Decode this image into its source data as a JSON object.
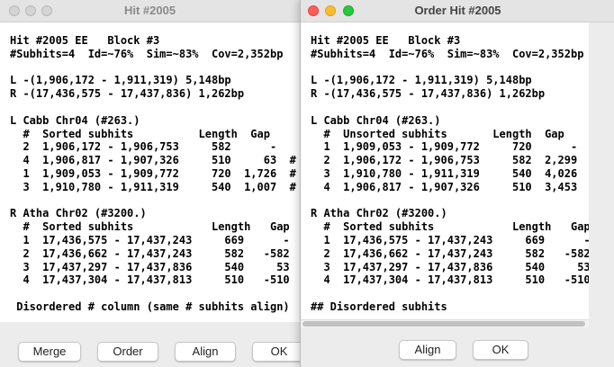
{
  "hit_window": {
    "title": "Hit #2005",
    "text": "Hit #2005 EE   Block #3\n#Subhits=4  Id=~76%  Sim=~83%  Cov=2,352bp\n\nL -(1,906,172 - 1,911,319) 5,148bp\nR -(17,436,575 - 17,437,836) 1,262bp\n\nL Cabb Chr04 (#263.)\n  #  Sorted subhits          Length  Gap\n  2  1,906,172 - 1,906,753     582      -\n  4  1,906,817 - 1,907,326     510     63  #\n  1  1,909,053 - 1,909,772     720  1,726  #\n  3  1,910,780 - 1,911,319     540  1,007  #\n\nR Atha Chr02 (#3200.)\n  #  Sorted subhits            Length   Gap\n  1  17,436,575 - 17,437,243     669      -\n  2  17,436,662 - 17,437,243     582   -582\n  3  17,437,297 - 17,437,836     540     53\n  4  17,437,304 - 17,437,813     510   -510\n\n Disordered # column (same # subhits align)",
    "buttons": {
      "merge": "Merge",
      "order": "Order",
      "align": "Align",
      "ok": "OK"
    }
  },
  "order_window": {
    "title": "Order Hit #2005",
    "text": "Hit #2005 EE   Block #3\n#Subhits=4  Id=~76%  Sim=~83%  Cov=2,352bp\n\nL -(1,906,172 - 1,911,319) 5,148bp\nR -(17,436,575 - 17,437,836) 1,262bp\n\nL Cabb Chr04 (#263.)\n  #  Unsorted subhits       Length  Gap\n  1  1,909,053 - 1,909,772     720      -\n  2  1,906,172 - 1,906,753     582  2,299  ##\n  3  1,910,780 - 1,911,319     540  4,026\n  4  1,906,817 - 1,907,326     510  3,453  ##\n\nR Atha Chr02 (#3200.)\n  #  Sorted subhits            Length   Gap\n  1  17,436,575 - 17,437,243     669      -\n  2  17,436,662 - 17,437,243     582   -582\n  3  17,437,297 - 17,437,836     540     53\n  4  17,437,304 - 17,437,813     510   -510\n\n## Disordered subhits",
    "buttons": {
      "align": "Align",
      "ok": "OK"
    }
  }
}
